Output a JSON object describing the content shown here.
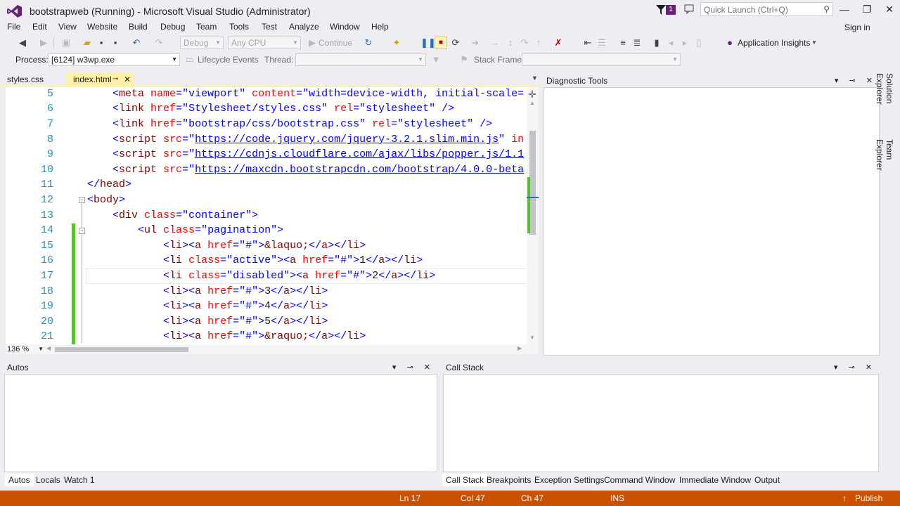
{
  "window": {
    "title": "bootstrapweb (Running) - Microsoft Visual Studio (Administrator)",
    "notification_count": "1",
    "quick_launch_placeholder": "Quick Launch (Ctrl+Q)",
    "sign_in": "Sign in"
  },
  "menu": [
    "File",
    "Edit",
    "View",
    "Website",
    "Build",
    "Debug",
    "Team",
    "Tools",
    "Test",
    "Analyze",
    "Window",
    "Help"
  ],
  "toolbar": {
    "config": "Debug",
    "platform": "Any CPU",
    "continue_label": "Continue",
    "app_insights": "Application Insights",
    "process_label": "Process:",
    "process_value": "[6124] w3wp.exe",
    "lifecycle_label": "Lifecycle Events",
    "thread_label": "Thread:",
    "stack_frame_label": "Stack Frame:"
  },
  "doc_tabs": {
    "styles": "styles.css",
    "index": "index.html"
  },
  "editor": {
    "zoom": "136 %",
    "line_numbers": [
      "5",
      "6",
      "7",
      "8",
      "9",
      "10",
      "11",
      "12",
      "13",
      "14",
      "15",
      "16",
      "17",
      "18",
      "19",
      "20",
      "21"
    ]
  },
  "panels": {
    "diagnostic": "Diagnostic Tools",
    "autos": "Autos",
    "callstack": "Call Stack",
    "solution_explorer": "Solution Explorer",
    "team_explorer": "Team Explorer"
  },
  "bottom_left_tabs": [
    "Autos",
    "Locals",
    "Watch 1"
  ],
  "bottom_right_tabs": [
    "Call Stack",
    "Breakpoints",
    "Exception Settings",
    "Command Window",
    "Immediate Window",
    "Output"
  ],
  "status": {
    "ln": "Ln 17",
    "col": "Col 47",
    "ch": "Ch 47",
    "mode": "INS",
    "publish": "Publish"
  },
  "colors": {
    "status_bar": "#ca5100",
    "active_tab": "#fff1a8",
    "accent": "#68217a"
  }
}
